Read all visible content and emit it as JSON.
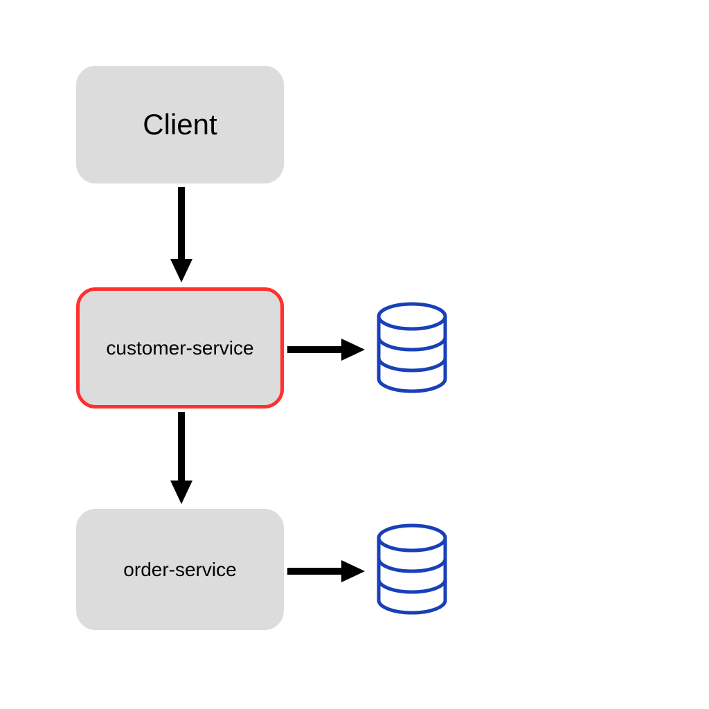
{
  "nodes": {
    "client": {
      "label": "Client"
    },
    "customer_service": {
      "label": "customer-service"
    },
    "order_service": {
      "label": "order-service"
    }
  },
  "icons": {
    "database1": "database",
    "database2": "database"
  }
}
